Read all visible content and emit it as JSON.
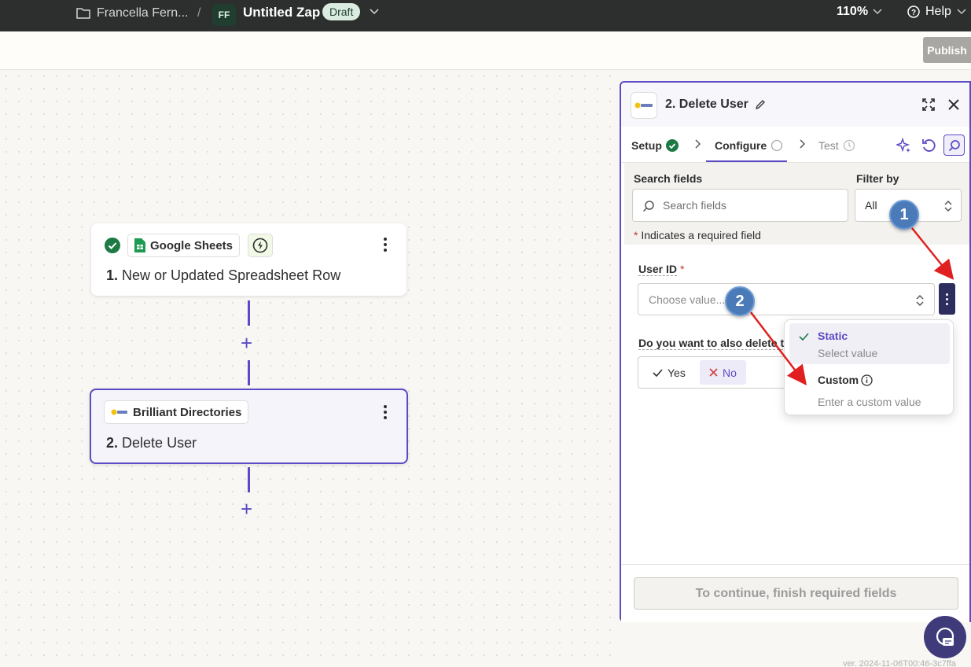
{
  "topbar": {
    "folder": "Francella Fern...",
    "separator": "/",
    "initials": "FF",
    "zap_name": "Untitled Zap",
    "status": "Draft",
    "zoom": "110%",
    "help": "Help"
  },
  "toolbar": {
    "publish": "Publish"
  },
  "canvas": {
    "step1": {
      "app": "Google Sheets",
      "number": "1.",
      "title": "New or Updated Spreadsheet Row"
    },
    "step2": {
      "app": "Brilliant Directories",
      "number": "2.",
      "title": "Delete User"
    },
    "add_step": "+"
  },
  "panel": {
    "title": "2. Delete User",
    "tabs": {
      "setup": "Setup",
      "configure": "Configure",
      "test": "Test"
    },
    "search_label": "Search fields",
    "search_placeholder": "Search fields",
    "filter_label": "Filter by",
    "filter_value": "All",
    "required_note": "Indicates a required field",
    "required_mark": "*",
    "user_id_label": "User ID",
    "user_id_placeholder": "Choose value...",
    "delete_question": "Do you want to also delete th",
    "yes": "Yes",
    "no": "No",
    "dropdown": {
      "static_title": "Static",
      "static_sub": "Select value",
      "custom_title": "Custom",
      "custom_sub": "Enter a custom value"
    },
    "continue": "To continue, finish required fields"
  },
  "annotations": {
    "badge1": "1",
    "badge2": "2"
  },
  "version": "ver. 2024-11-06T00:46-3c7ffa",
  "colors": {
    "accent": "#5b4bc4",
    "topbar": "#2d2e2e",
    "annotation": "#e02020"
  }
}
